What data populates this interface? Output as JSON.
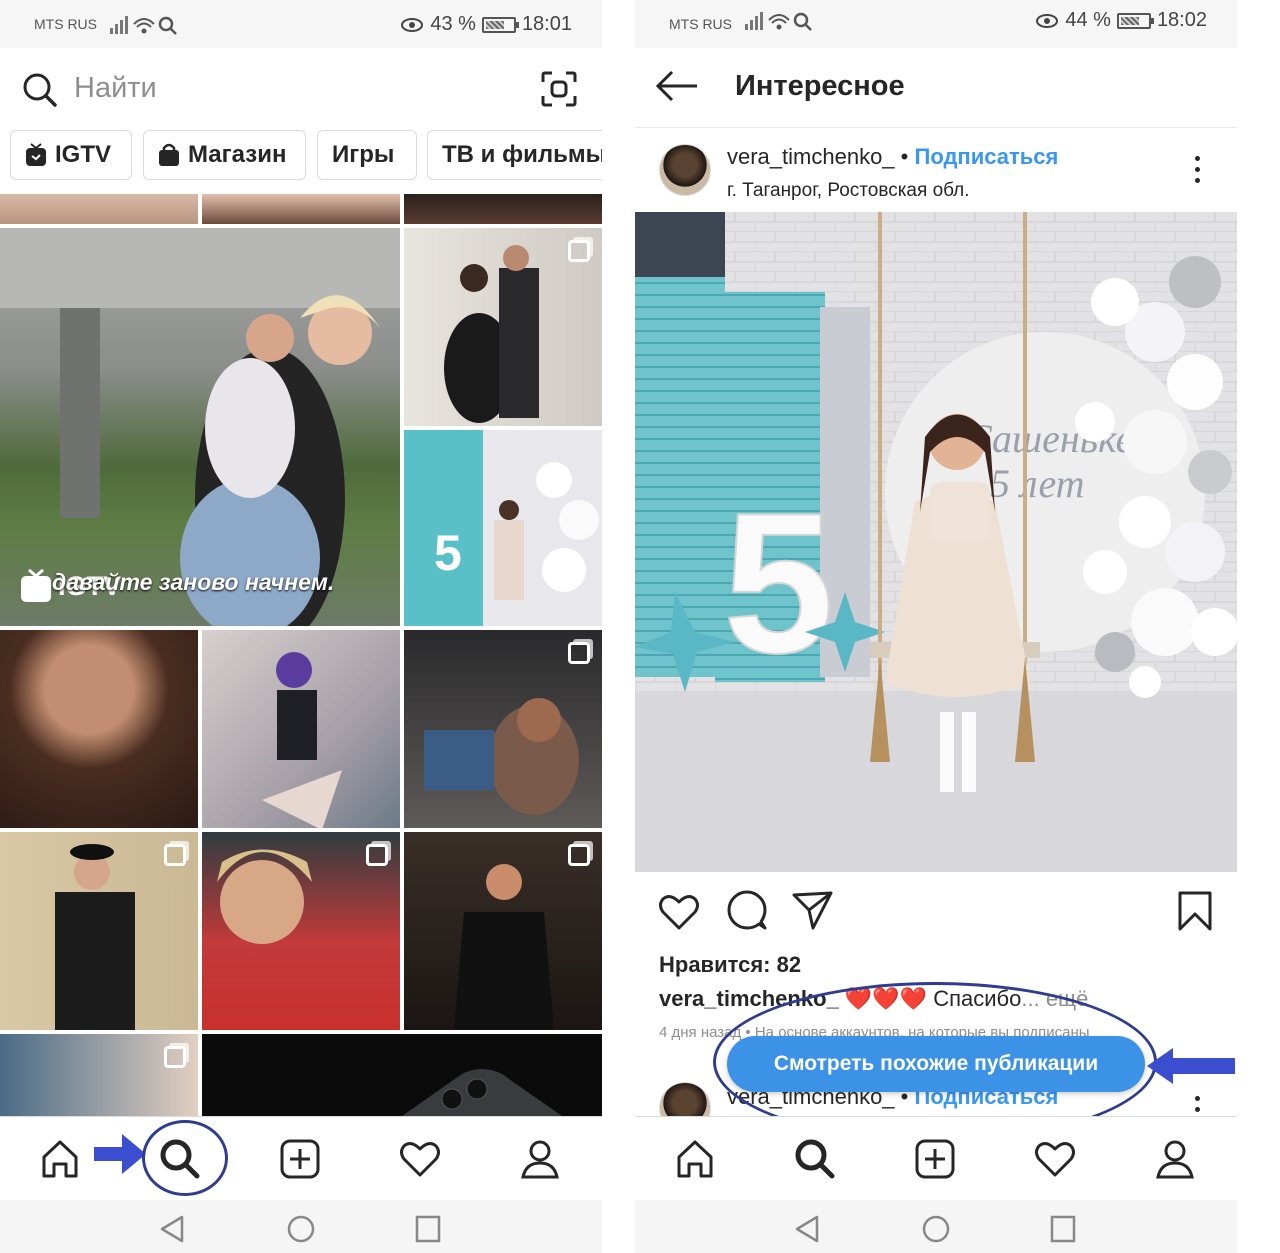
{
  "left": {
    "status": {
      "carrier": "MTS RUS",
      "battery": "43 %",
      "time": "18:01"
    },
    "search": {
      "placeholder": "Найти"
    },
    "chips": [
      {
        "label": "IGTV",
        "icon": "igtv-icon"
      },
      {
        "label": "Магазин",
        "icon": "shopping-bag-icon"
      },
      {
        "label": "Игры"
      },
      {
        "label": "ТВ и фильмы"
      }
    ],
    "igtv_tile": {
      "badge": "IGTV",
      "caption": "давайте заново начнем."
    },
    "tabs": [
      "home-icon",
      "search-icon",
      "add-icon",
      "heart-icon",
      "profile-icon"
    ]
  },
  "right": {
    "status": {
      "carrier": "MTS RUS",
      "battery": "44 %",
      "time": "18:02"
    },
    "header": {
      "title": "Интересное"
    },
    "post": {
      "username": "vera_timchenko_",
      "separator": "•",
      "follow": "Подписаться",
      "location": "г. Таганрог, Ростовская обл.",
      "image_text_1": "Сашеньке",
      "image_text_2": "5 лет",
      "likes": "Нравится: 82",
      "caption_user": "vera_timchenko_",
      "caption_emoji": "❤️❤️❤️",
      "caption_text": "Спасибо",
      "caption_more": "... ещё",
      "time_ago": "4 дня назад • На основе аккаунтов, на которые вы подписаны"
    },
    "similar_button": "Смотреть похожие публикации",
    "next_post": {
      "username": "vera_timchenko_",
      "separator": "•",
      "follow": "Подписаться"
    }
  },
  "colors": {
    "accent": "#3897f0",
    "button": "#3c92e6",
    "annotation": "#2f3c92",
    "arrow": "#3b4ecf"
  }
}
